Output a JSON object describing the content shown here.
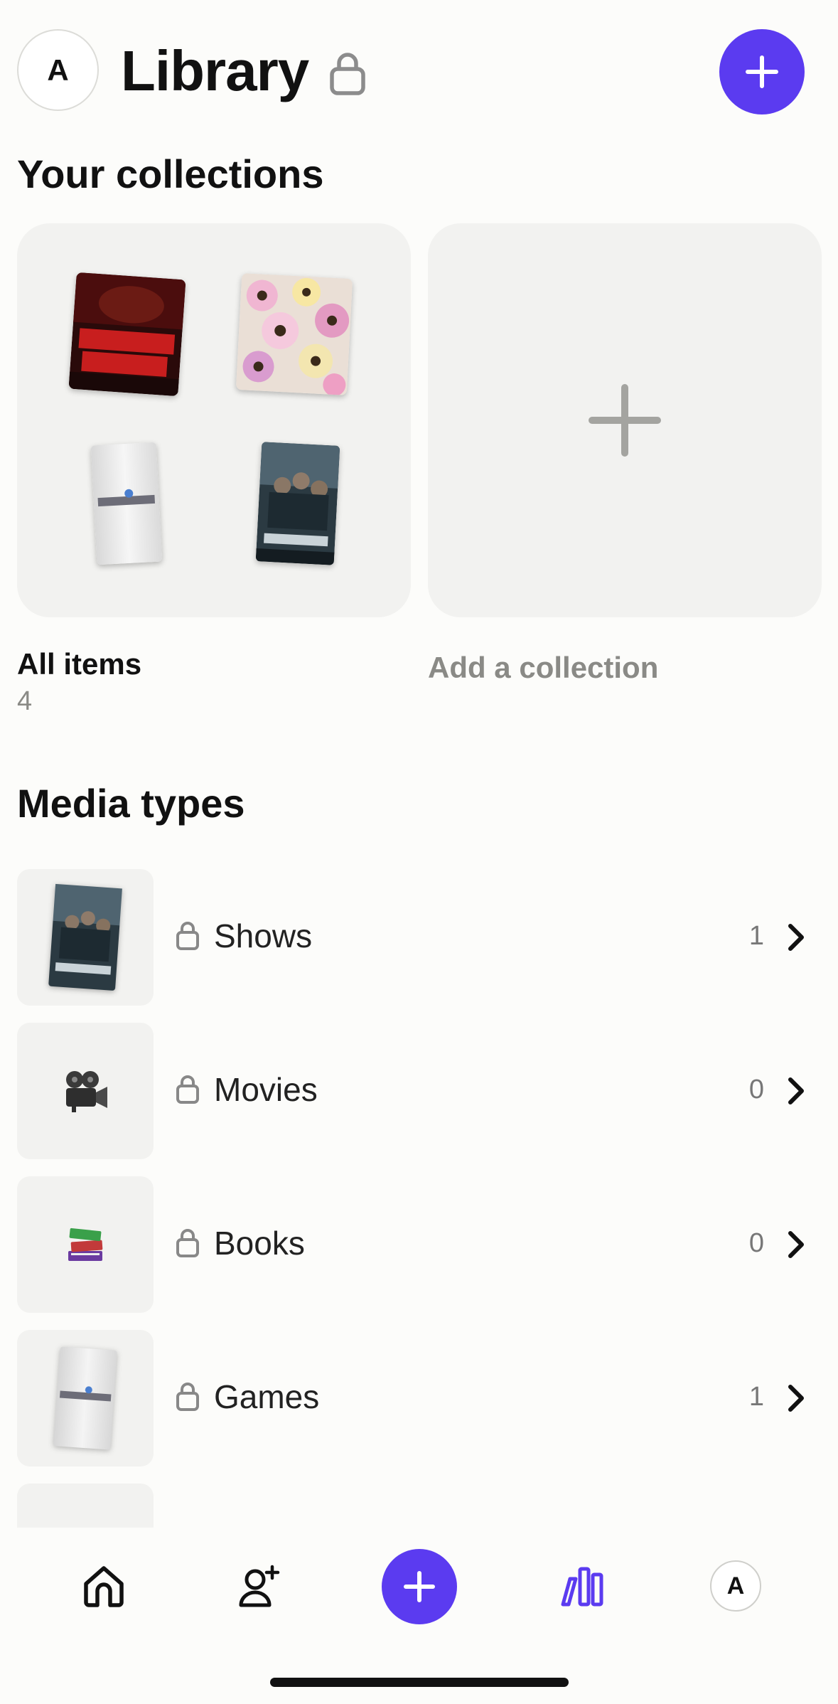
{
  "header": {
    "avatar_initial": "A",
    "title": "Library",
    "title_icon": "lock-icon",
    "add_icon": "plus-icon"
  },
  "collections": {
    "heading": "Your collections",
    "all_items": {
      "label": "All items",
      "count": "4",
      "covers": [
        "alter-ego-album-cover",
        "floral-album-cover",
        "final-fantasy-game-cover",
        "peaky-blinders-show-cover"
      ]
    },
    "add_collection": {
      "label": "Add a collection",
      "icon": "plus-icon"
    }
  },
  "media_types": {
    "heading": "Media types",
    "items": [
      {
        "label": "Shows",
        "count": "1",
        "thumb": "peaky-blinders-show-cover"
      },
      {
        "label": "Movies",
        "count": "0",
        "thumb": "movie-camera-icon"
      },
      {
        "label": "Books",
        "count": "0",
        "thumb": "books-icon"
      },
      {
        "label": "Games",
        "count": "1",
        "thumb": "final-fantasy-game-cover"
      }
    ]
  },
  "bottom_nav": {
    "items": [
      "home-icon",
      "add-friend-icon",
      "plus-icon",
      "library-icon",
      "profile-avatar"
    ],
    "avatar_initial": "A",
    "active": "library-icon"
  },
  "colors": {
    "accent": "#5b3bf0",
    "background": "#fcfcfa",
    "card": "#f2f2f0",
    "muted_text": "#8a8a86"
  }
}
